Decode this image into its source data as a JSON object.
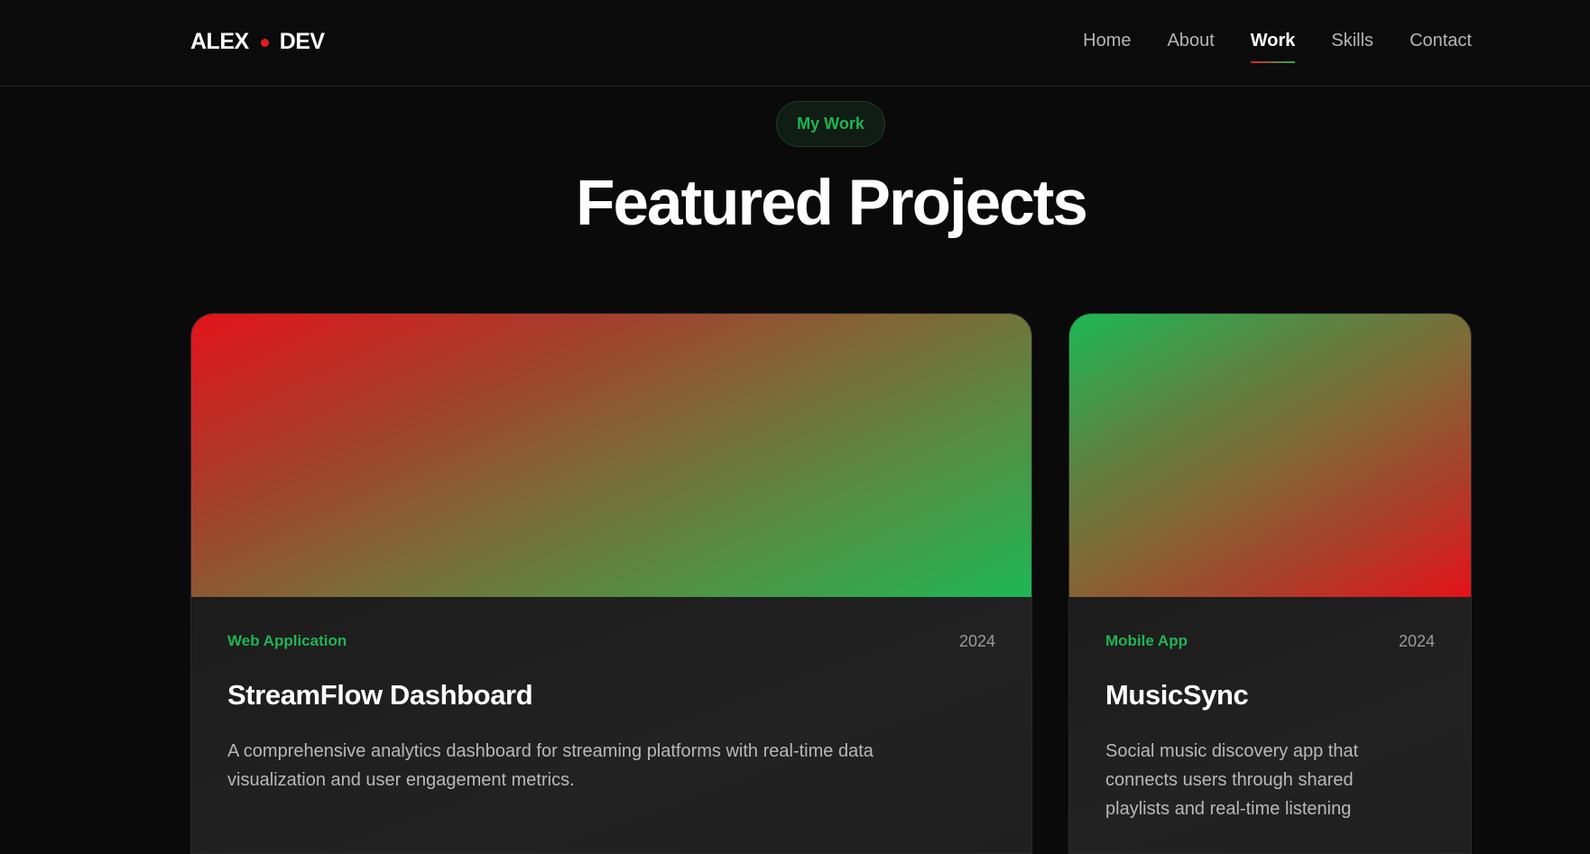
{
  "header": {
    "logo_left": "ALEX",
    "logo_right": "DEV",
    "nav": [
      {
        "label": "Home"
      },
      {
        "label": "About"
      },
      {
        "label": "Work"
      },
      {
        "label": "Skills"
      },
      {
        "label": "Contact"
      }
    ],
    "active_nav": "Work"
  },
  "section": {
    "badge": "My Work",
    "title": "Featured Projects"
  },
  "projects": [
    {
      "category": "Web Application",
      "year": "2024",
      "title": "StreamFlow Dashboard",
      "description": "A comprehensive analytics dashboard for streaming platforms with real-time data visualization and user engagement metrics."
    },
    {
      "category": "Mobile App",
      "year": "2024",
      "title": "MusicSync",
      "description": "Social music discovery app that connects users through shared playlists and real-time listening"
    }
  ],
  "colors": {
    "accent_red": "#e11d23",
    "accent_green": "#22b354",
    "background": "#0a0a0a",
    "card": "#1d1d1d"
  }
}
